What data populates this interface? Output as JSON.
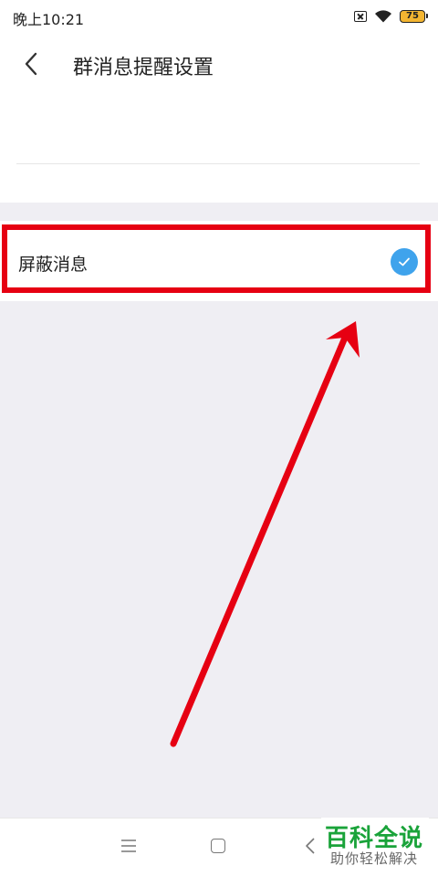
{
  "status_bar": {
    "time": "晚上10:21",
    "battery_level": "75",
    "battery_color": "#f3b531",
    "icons": [
      "no-sim-icon",
      "wifi-icon",
      "battery-icon"
    ]
  },
  "header": {
    "back_icon": "chevron-left-icon",
    "title": "群消息提醒设置"
  },
  "settings": {
    "mute_label": "屏蔽消息",
    "mute_checked": true,
    "check_color": "#3fa3ec"
  },
  "annotation": {
    "highlight_color": "#e60012",
    "arrow_icon": "red-arrow-annotation"
  },
  "nav_bar": {
    "icons": [
      "menu-icon",
      "home-icon",
      "back-icon"
    ]
  },
  "watermark": {
    "title": "百科全说",
    "subtitle": "助你轻松解决",
    "color": "#1aa33a"
  }
}
